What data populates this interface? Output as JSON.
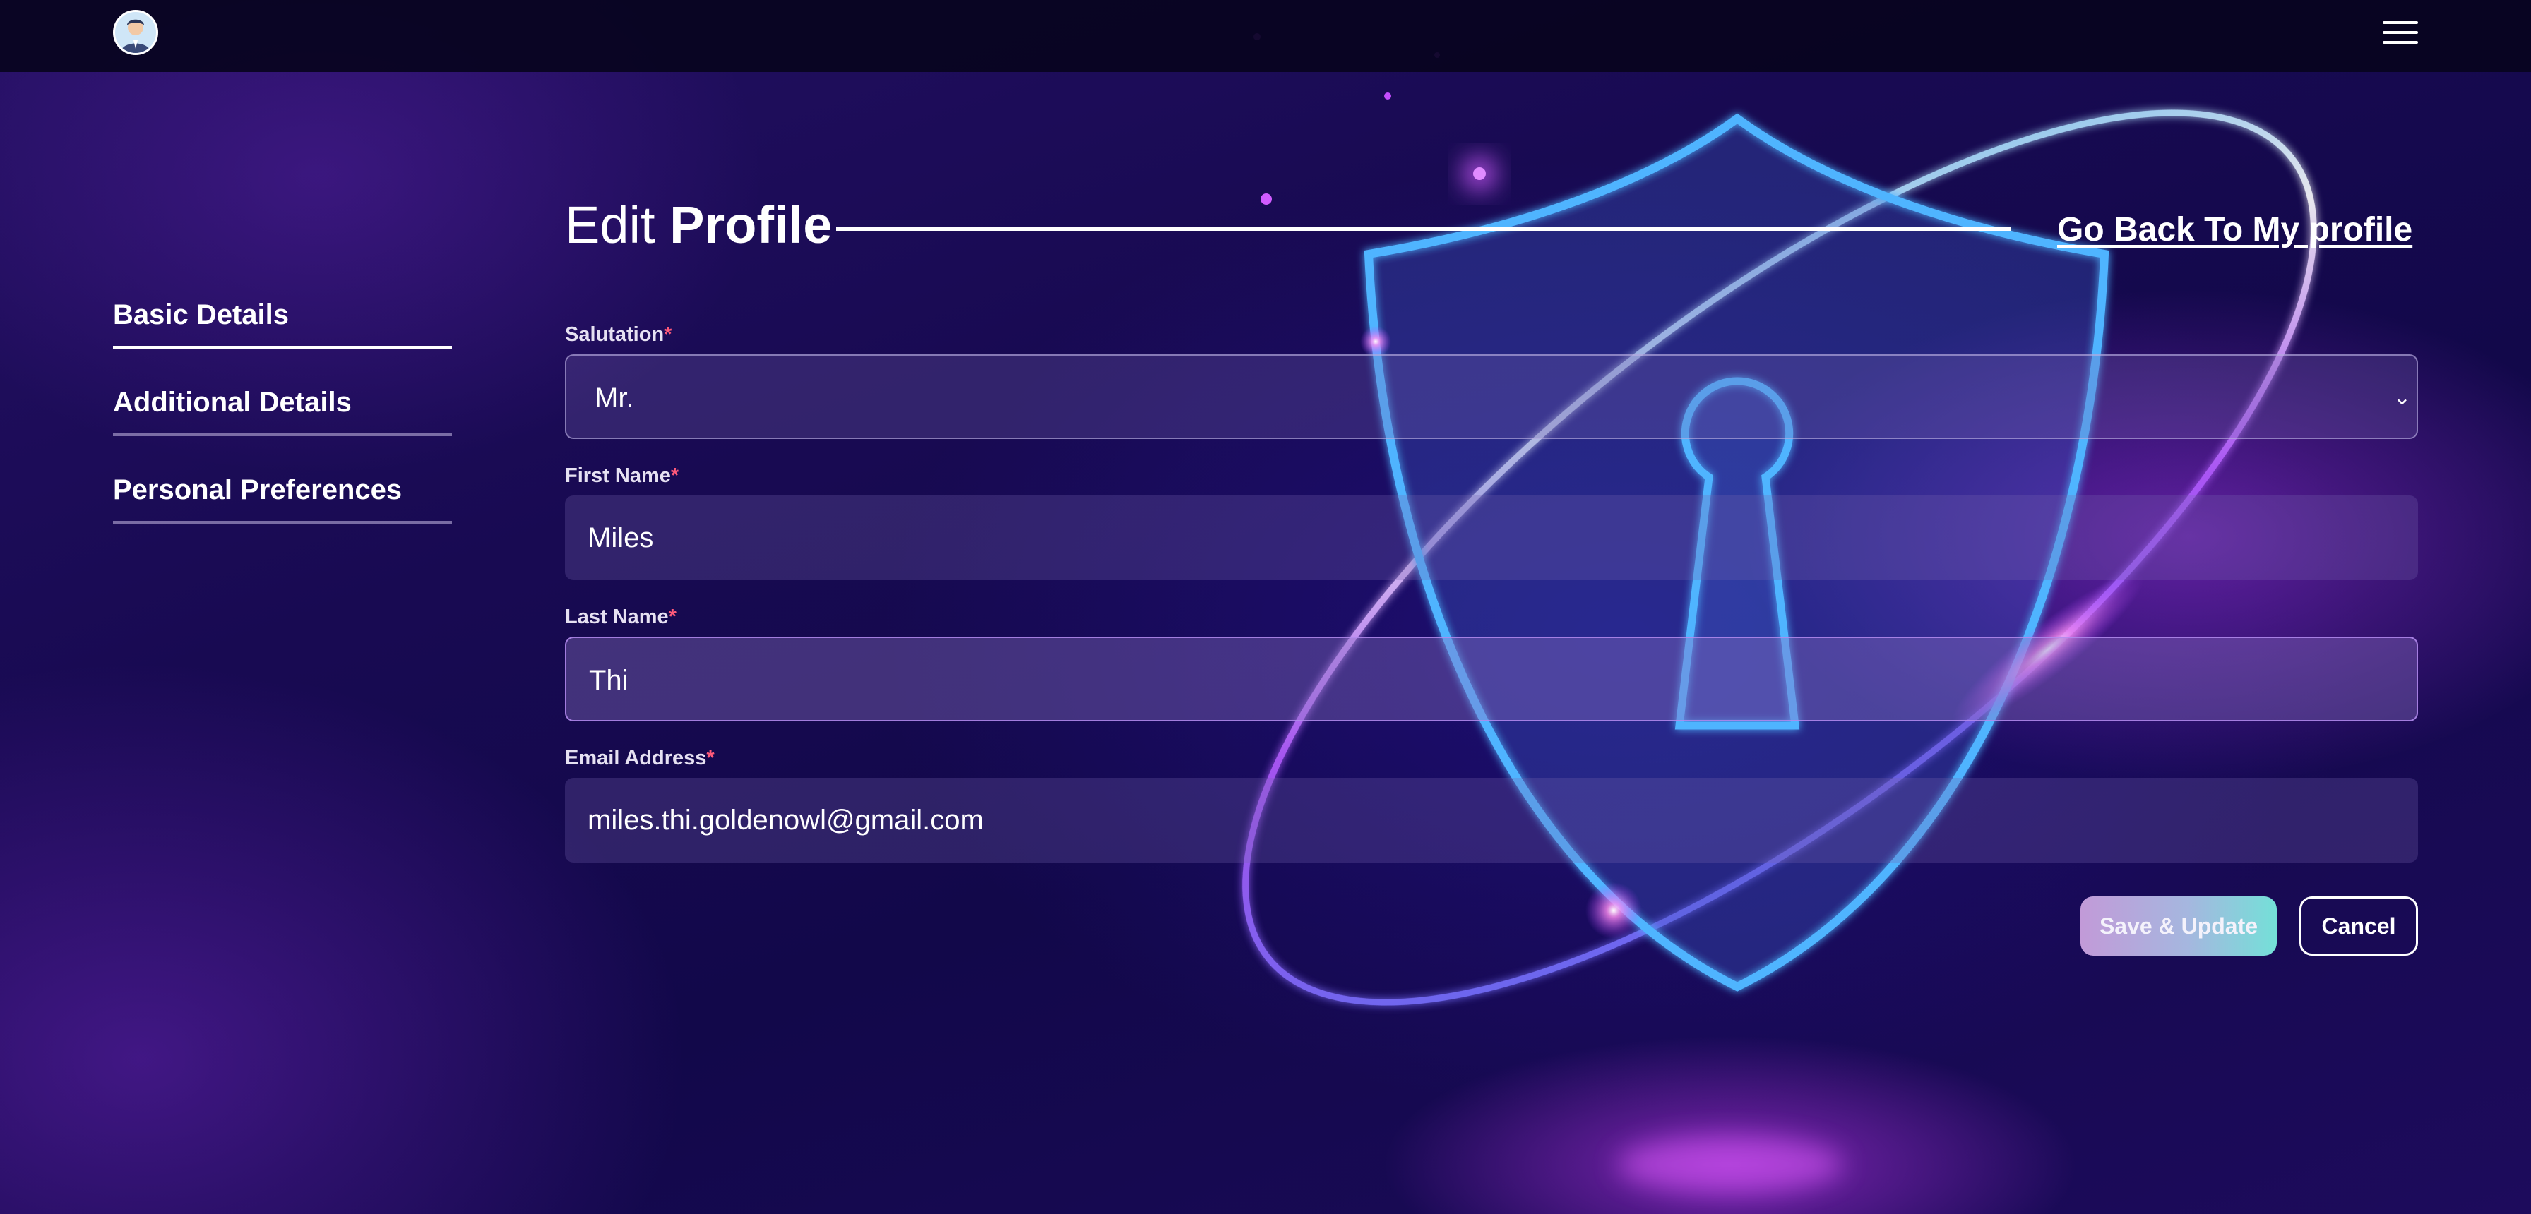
{
  "header": {
    "avatar_icon": "user-avatar-icon",
    "menu_icon": "hamburger-menu-icon"
  },
  "sidebar": {
    "items": [
      {
        "label": "Basic Details",
        "active": true
      },
      {
        "label": "Additional Details",
        "active": false
      },
      {
        "label": "Personal Preferences",
        "active": false
      }
    ]
  },
  "page": {
    "title_light": "Edit",
    "title_bold": "Profile",
    "back_link": "Go Back To My profile"
  },
  "form": {
    "salutation": {
      "label": "Salutation",
      "required_mark": "*",
      "value": "Mr."
    },
    "first_name": {
      "label": "First Name",
      "required_mark": "*",
      "value": "Miles"
    },
    "last_name": {
      "label": "Last Name",
      "required_mark": "*",
      "value": "Thi"
    },
    "email": {
      "label": "Email Address",
      "required_mark": "*",
      "value": "miles.thi.goldenowl@gmail.com"
    }
  },
  "actions": {
    "save_label": "Save & Update",
    "cancel_label": "Cancel"
  },
  "colors": {
    "accent_required": "#ff5a7a",
    "save_gradient_start": "#c29ad8",
    "save_gradient_end": "#74e0d8",
    "background": "#180a52"
  }
}
